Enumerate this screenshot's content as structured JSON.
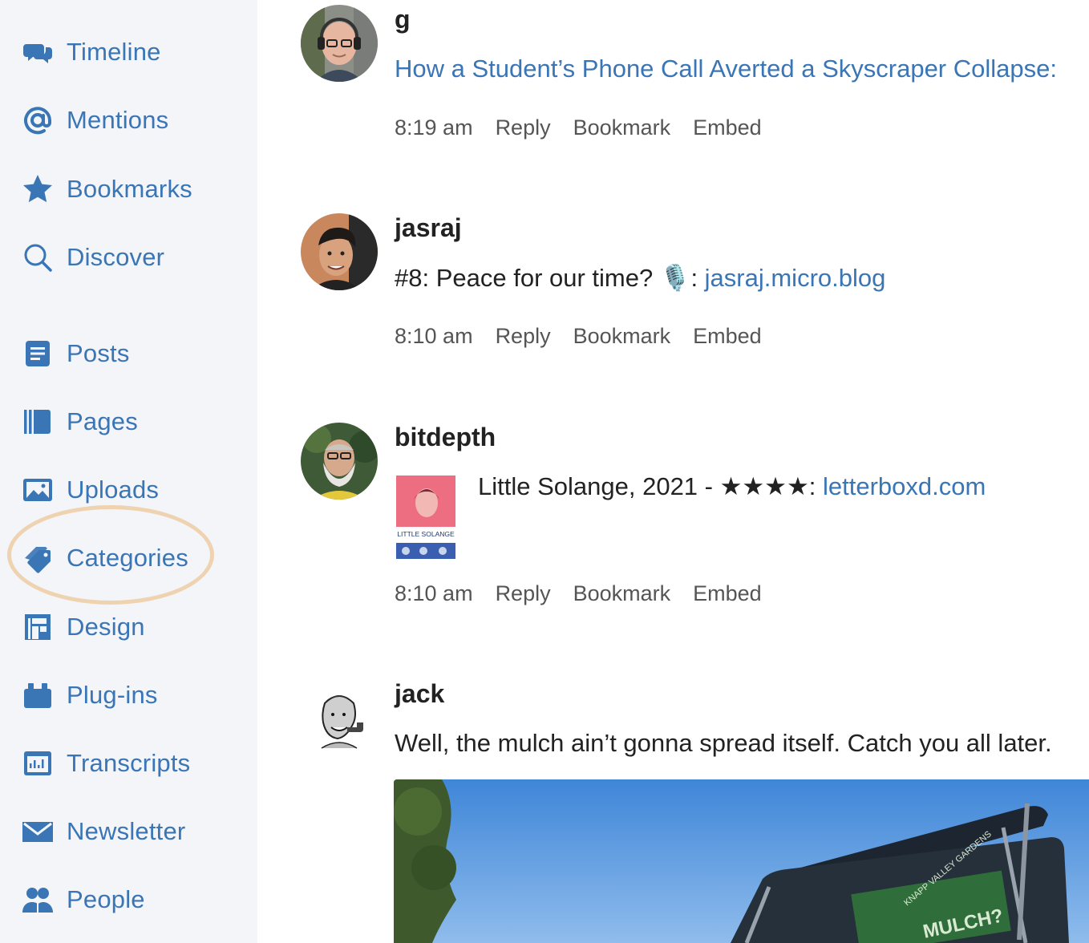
{
  "sidebar": {
    "items": [
      {
        "label": "Timeline",
        "icon": "chat-bubbles-icon"
      },
      {
        "label": "Mentions",
        "icon": "at-sign-icon"
      },
      {
        "label": "Bookmarks",
        "icon": "star-icon"
      },
      {
        "label": "Discover",
        "icon": "search-icon"
      },
      {
        "label": "Posts",
        "icon": "document-icon"
      },
      {
        "label": "Pages",
        "icon": "book-icon"
      },
      {
        "label": "Uploads",
        "icon": "image-icon"
      },
      {
        "label": "Categories",
        "icon": "tags-icon"
      },
      {
        "label": "Design",
        "icon": "layout-icon"
      },
      {
        "label": "Plug-ins",
        "icon": "plugin-icon"
      },
      {
        "label": "Transcripts",
        "icon": "audio-waveform-icon"
      },
      {
        "label": "Newsletter",
        "icon": "envelope-icon"
      },
      {
        "label": "People",
        "icon": "people-icon"
      }
    ]
  },
  "colors": {
    "accent": "#3a75b5",
    "sidebar_bg": "#f3f5f9",
    "highlight_ring": "#efd3b0"
  },
  "feed": {
    "posts": [
      {
        "username": "g",
        "text_before": "",
        "link": "How a Student’s Phone Call Averted a Skyscraper Collapse:",
        "text_after": "",
        "time": "8:19 am",
        "actions": [
          "Reply",
          "Bookmark",
          "Embed"
        ]
      },
      {
        "username": "jasraj",
        "text_before": "#8: Peace for our time? 🎙️: ",
        "link": "jasraj.micro.blog",
        "text_after": "",
        "time": "8:10 am",
        "actions": [
          "Reply",
          "Bookmark",
          "Embed"
        ]
      },
      {
        "username": "bitdepth",
        "text_before": "Little Solange, 2021 - ★★★★: ",
        "link": "letterboxd.com",
        "text_after": "",
        "poster_caption": "LITTLE SOLANGE",
        "time": "8:10 am",
        "actions": [
          "Reply",
          "Bookmark",
          "Embed"
        ]
      },
      {
        "username": "jack",
        "text_before": "Well, the mulch ain’t gonna spread itself. Catch you all later.",
        "link": "",
        "text_after": "",
        "photo_sign_line1": "KNAPP VALLEY GARDENS",
        "photo_sign_line2": "MULCH?"
      }
    ]
  }
}
